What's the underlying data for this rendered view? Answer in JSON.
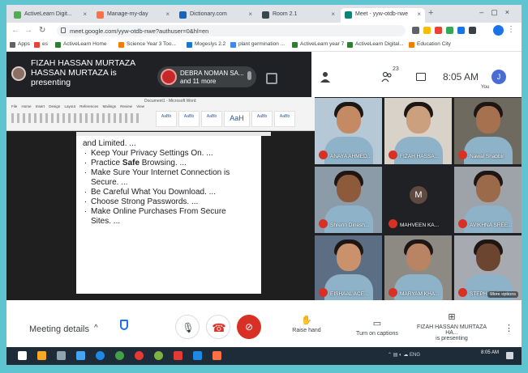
{
  "browser": {
    "tabs": [
      {
        "label": "ActiveLearn Digit...",
        "active": false
      },
      {
        "label": "Manage-my-day",
        "active": false
      },
      {
        "label": "Dictionary.com",
        "active": false
      },
      {
        "label": "Room 2.1",
        "active": false
      },
      {
        "label": "Meet - yyw-otdb-nwe",
        "active": true
      }
    ],
    "url": "meet.google.com/yyw-otdb-nwe?authuser=0&hl=en",
    "bookmarks": [
      "Apps",
      "es",
      "ActiveLearn Home",
      "Science Year 3 Too...",
      "Mogeslys 2.2",
      "plant germination ...",
      "ActiveLearn year 7",
      "ActiveLearn Digital...",
      "Education City"
    ]
  },
  "meet": {
    "presenter_line1": "FIZAH HASSAN MURTAZA",
    "presenter_line2": "HASSAN MURTAZA is",
    "presenter_line3": "presenting",
    "chip_name": "DEBRA NOMAN SA...",
    "chip_more": "and 11 more",
    "people_count": "23",
    "time": "8:05 AM",
    "you_initial": "J",
    "you_label": "You"
  },
  "doc": {
    "title": "Document1 - Microsoft Word",
    "menu": "File Home Insert Design Layout References Mailings Review View",
    "style_big": "AaH",
    "lines": [
      {
        "text": "and Limited. ...",
        "bullet": false
      },
      {
        "text": "Keep Your Privacy Settings On. ...",
        "bullet": true
      },
      {
        "pre": "Practice ",
        "bold": "Safe",
        "post": " Browsing. ...",
        "bullet": true
      },
      {
        "text": "Make Sure Your Internet Connection is",
        "bullet": true
      },
      {
        "text": "Secure. ...",
        "bullet": false
      },
      {
        "text": "Be Careful What You Download. ...",
        "bullet": true
      },
      {
        "text": "Choose Strong Passwords. ...",
        "bullet": true
      },
      {
        "text": "Make Online Purchases From Secure",
        "bullet": true
      },
      {
        "text": "Sites. ...",
        "bullet": false
      }
    ]
  },
  "participants": [
    {
      "name": "ANAYA AHMED...",
      "bg": "#b6c7d6",
      "skin": "#c48a63"
    },
    {
      "name": "FIZAH HASSA...",
      "bg": "#d9d2c8",
      "skin": "#caa07e"
    },
    {
      "name": "Nawal Shabbir",
      "bg": "#6e6a5f",
      "skin": "#a6714f"
    },
    {
      "name": "Shrenn Dinesh...",
      "bg": "#8b9ba7",
      "skin": "#8d5a3c"
    },
    {
      "name": "MAHVEEN KA...",
      "bg": "#202124",
      "skin": "",
      "letter": "M"
    },
    {
      "name": "AVIKHNA SREE...",
      "bg": "#9da3a8",
      "skin": "#9b6a4b"
    },
    {
      "name": "EISHAAL ACE...",
      "bg": "#5b6e84",
      "skin": "#c9926d"
    },
    {
      "name": "MARYAM KHA...",
      "bg": "#8d8a84",
      "skin": "#b88463"
    },
    {
      "name": "STEPHANIE W...",
      "bg": "#a7aab0",
      "skin": "#6b4530"
    }
  ],
  "see_more": "More options",
  "controls": {
    "meeting_details": "Meeting details",
    "raise_hand": "Raise hand",
    "captions": "Turn on captions",
    "presenting_line1": "FIZAH HASSAN MURTAZA HA...",
    "presenting_line2": "is presenting"
  },
  "taskbar": {
    "tray": "ENG",
    "time": "8:05 AM"
  },
  "colors": {
    "frame": "#5ec4cf",
    "meet_dark": "#202124",
    "mute_red": "#d93025",
    "accent_blue": "#1a73e8"
  }
}
